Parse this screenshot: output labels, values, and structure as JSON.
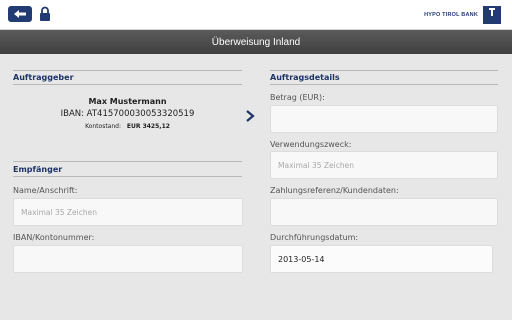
{
  "header": {
    "brand_name": "HYPO TIROL BANK",
    "title": "Überweisung Inland"
  },
  "colors": {
    "brand": "#233b73",
    "title_bar": "#4a4a4a",
    "background": "#e7e7e7"
  },
  "icons": {
    "back": "arrow-left-icon",
    "lock": "lock-icon",
    "chevron": "chevron-right-icon"
  },
  "sender": {
    "heading": "Auftraggeber",
    "name": "Max Mustermann",
    "iban_line": "IBAN: AT415700030053320519",
    "balance_label": "Kontostand:",
    "balance_value": "EUR 3425,12"
  },
  "recipient": {
    "heading": "Empfänger",
    "name_label": "Name/Anschrift:",
    "name_placeholder": "Maximal 35 Zeichen",
    "iban_label": "IBAN/Kontonummer:",
    "iban_value": ""
  },
  "details": {
    "heading": "Auftragsdetails",
    "amount_label": "Betrag (EUR):",
    "amount_value": "",
    "purpose_label": "Verwendungszweck:",
    "purpose_placeholder": "Maximal 35 Zeichen",
    "reference_label": "Zahlungsreferenz/Kundendaten:",
    "reference_value": "",
    "date_label": "Durchführungsdatum:",
    "date_value": "2013-05-14"
  }
}
